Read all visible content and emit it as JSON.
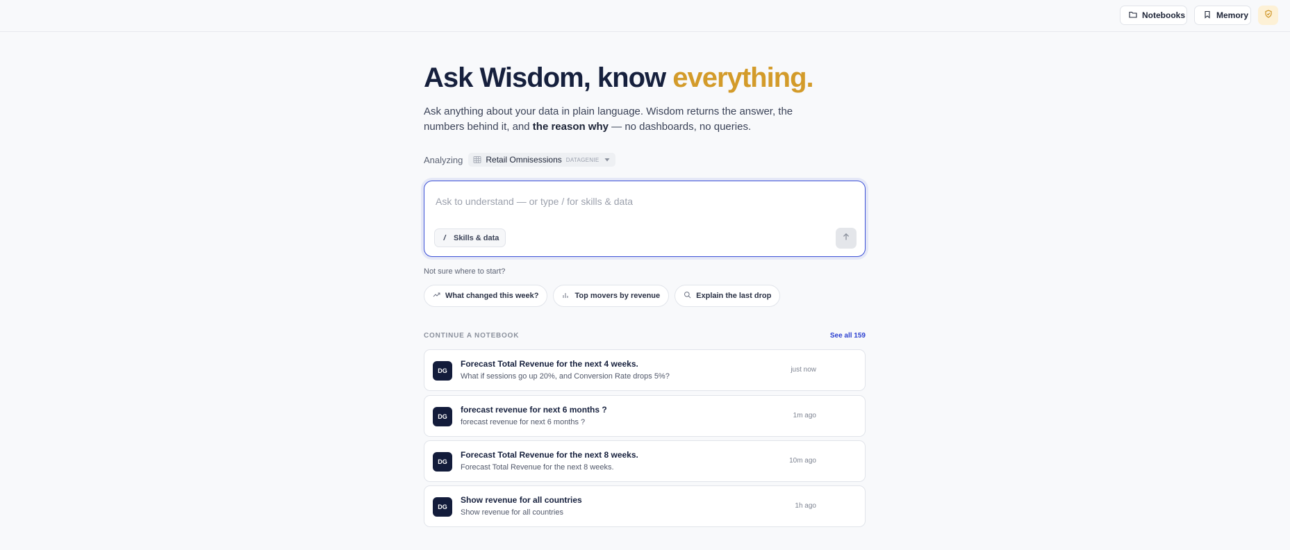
{
  "header": {
    "notebooks_label": "Notebooks",
    "memory_label": "Memory"
  },
  "hero": {
    "title_main": "Ask Wisdom, know ",
    "title_accent": "everything.",
    "subtitle_part1": "Ask anything about your data in plain language. Wisdom returns the answer, the numbers behind it, and ",
    "subtitle_bold": "the reason why",
    "subtitle_part2": " — no dashboards, no queries."
  },
  "analyzing": {
    "label": "Analyzing",
    "dataset_name": "Retail Omnisessions",
    "dataset_tag": "DATAGENIE"
  },
  "ask": {
    "placeholder": "Ask to understand — or type / for skills & data",
    "value": "",
    "skills_key": "/",
    "skills_label": "Skills & data"
  },
  "suggestions": {
    "label": "Not sure where to start?",
    "items": [
      {
        "label": "What changed this week?",
        "icon": "trend-up-icon"
      },
      {
        "label": "Top movers by revenue",
        "icon": "bar-chart-icon"
      },
      {
        "label": "Explain the last drop",
        "icon": "search-icon"
      }
    ]
  },
  "notebooks": {
    "section_label": "CONTINUE A NOTEBOOK",
    "see_all": "See all 159",
    "items": [
      {
        "avatar": "DG",
        "title": "Forecast Total Revenue for the next 4 weeks.",
        "subtitle": "What if sessions go up 20%, and Conversion Rate drops 5%?",
        "time": "just now"
      },
      {
        "avatar": "DG",
        "title": "forecast revenue for next 6 months ?",
        "subtitle": "forecast revenue for next 6 months ?",
        "time": "1m ago"
      },
      {
        "avatar": "DG",
        "title": "Forecast Total Revenue for the next 8 weeks.",
        "subtitle": "Forecast Total Revenue for the next 8 weeks.",
        "time": "10m ago"
      },
      {
        "avatar": "DG",
        "title": "Show revenue for all countries",
        "subtitle": "Show revenue for all countries",
        "time": "1h ago"
      }
    ]
  },
  "colors": {
    "accent": "#d39b2a",
    "primary": "#3a4fd6",
    "navy": "#131c3b",
    "link": "#2a3fd0"
  }
}
